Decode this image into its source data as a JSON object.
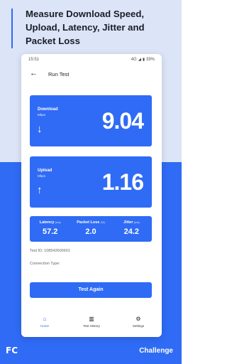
{
  "headline": "Measure Download Speed, Upload, Latency, Jitter and Packet Loss",
  "status_bar": {
    "time": "15:51",
    "network": "4G",
    "battery": "39%"
  },
  "app": {
    "title": "Run Test",
    "back_icon": "arrow-left-icon"
  },
  "download": {
    "label": "Download",
    "unit": "Mbps",
    "value": "9.04",
    "icon": "arrow-down-icon"
  },
  "upload": {
    "label": "Upload",
    "unit": "Mbps",
    "value": "1.16",
    "icon": "arrow-up-icon"
  },
  "stats": [
    {
      "label": "Latency",
      "unit": "(ms)",
      "value": "57.2"
    },
    {
      "label": "Packet Loss",
      "unit": "(%)",
      "value": "2.0"
    },
    {
      "label": "Jitter",
      "unit": "(ms)",
      "value": "24.2"
    }
  ],
  "test_id": "Test ID: 108542600601",
  "connection_type": "Connection Type:",
  "test_again_label": "Test Again",
  "nav": [
    {
      "label": "Home",
      "icon": "home-icon",
      "active": true
    },
    {
      "label": "Test History",
      "icon": "history-icon",
      "active": false
    },
    {
      "label": "Settings",
      "icon": "gear-icon",
      "active": false
    }
  ],
  "footer": {
    "fcc_logo": "FC",
    "brand": "Challenge"
  },
  "colors": {
    "accent": "#2f6bf5",
    "background_top": "#dce5f7",
    "headline": "#1a1d29"
  }
}
